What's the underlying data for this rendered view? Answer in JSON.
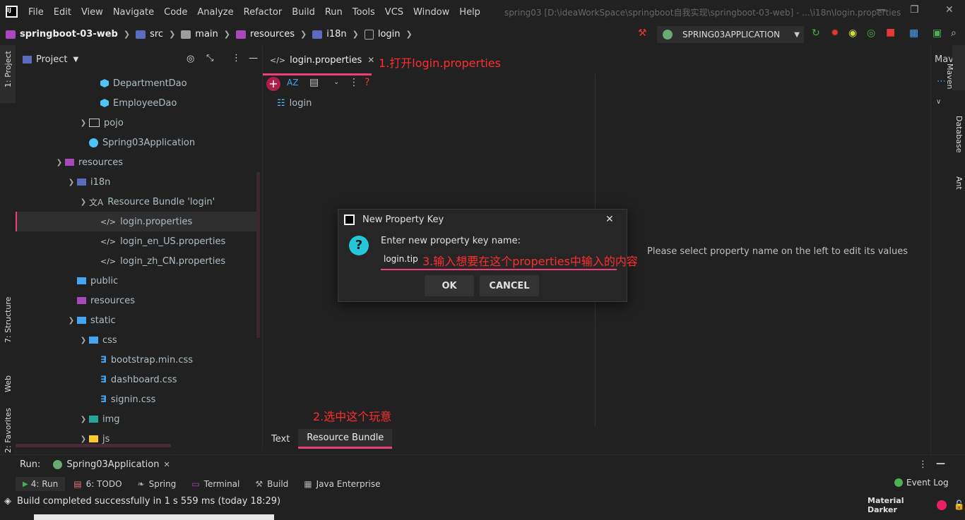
{
  "menubar": {
    "items": [
      "File",
      "Edit",
      "View",
      "Navigate",
      "Code",
      "Analyze",
      "Refactor",
      "Build",
      "Run",
      "Tools",
      "VCS",
      "Window",
      "Help"
    ],
    "window_title": "spring03 [D:\\ideaWorkSpace\\springboot自我实现\\springboot-03-web] - ...\\i18n\\login.properties"
  },
  "navbar": {
    "project": "springboot-03-web",
    "crumbs": [
      "src",
      "main",
      "resources",
      "i18n",
      "login"
    ],
    "run_config": "SPRING03APPLICATION"
  },
  "left_strip": {
    "project": "1: Project",
    "structure": "7: Structure",
    "web": "Web",
    "favorites": "2: Favorites"
  },
  "project_panel": {
    "title": "Project",
    "tree": [
      {
        "label": "DepartmentDao"
      },
      {
        "label": "EmployeeDao"
      },
      {
        "label": "pojo"
      },
      {
        "label": "Spring03Application"
      },
      {
        "label": "resources"
      },
      {
        "label": "i18n"
      },
      {
        "label": "Resource Bundle 'login'"
      },
      {
        "label": "login.properties"
      },
      {
        "label": "login_en_US.properties"
      },
      {
        "label": "login_zh_CN.properties"
      },
      {
        "label": "public"
      },
      {
        "label": "resources"
      },
      {
        "label": "static"
      },
      {
        "label": "css"
      },
      {
        "label": "bootstrap.min.css"
      },
      {
        "label": "dashboard.css"
      },
      {
        "label": "signin.css"
      },
      {
        "label": "img"
      },
      {
        "label": "js"
      }
    ]
  },
  "editor": {
    "tab_label": "login.properties",
    "bundle_item": "login",
    "placeholder_msg": "Please select property name on the left to edit its values",
    "bottom_tabs": [
      "Text",
      "Resource Bundle"
    ]
  },
  "right_strip": {
    "maven_tab": "Mav",
    "maven": "Maven",
    "database": "Database",
    "ant": "Ant"
  },
  "dialog": {
    "title": "New Property Key",
    "prompt": "Enter new property key name:",
    "input_value": "login.tip",
    "ok": "OK",
    "cancel": "CANCEL"
  },
  "annotations": {
    "a1": "1.打开login.properties",
    "a2": "2.选中这个玩意",
    "a3": "3.输入想要在这个properties中输入的内容"
  },
  "run_bar": {
    "label": "Run:",
    "config": "Spring03Application"
  },
  "tool_tabs": [
    "4: Run",
    "6: TODO",
    "Spring",
    "Terminal",
    "Build",
    "Java Enterprise"
  ],
  "event_log": "Event Log",
  "status": {
    "message": "Build completed successfully in 1 s 559 ms (today 18:29)",
    "theme": "Material Darker"
  },
  "colors": {
    "accent": "#ec407a",
    "annotation": "#ff2d2d",
    "background": "#212121"
  }
}
